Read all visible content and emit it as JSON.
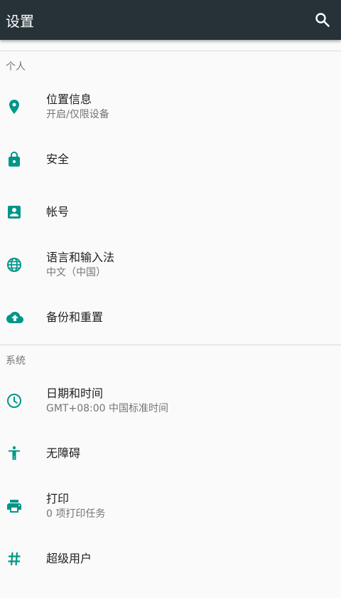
{
  "appbar": {
    "title": "设置",
    "search_icon": "search-icon"
  },
  "colors": {
    "appbar": "#263238",
    "accent": "#009688",
    "background": "#fafafa"
  },
  "sections": [
    {
      "header": "个人",
      "items": [
        {
          "label": "位置信息",
          "summary": "开启/仅限设备",
          "icon": "location-pin-icon"
        },
        {
          "label": "安全",
          "summary": "",
          "icon": "lock-icon"
        },
        {
          "label": "帐号",
          "summary": "",
          "icon": "account-box-icon"
        },
        {
          "label": "语言和输入法",
          "summary": "中文（中国）",
          "icon": "globe-icon"
        },
        {
          "label": "备份和重置",
          "summary": "",
          "icon": "cloud-upload-icon"
        }
      ]
    },
    {
      "header": "系统",
      "items": [
        {
          "label": "日期和时间",
          "summary": "GMT+08:00 中国标准时间",
          "icon": "clock-icon"
        },
        {
          "label": "无障碍",
          "summary": "",
          "icon": "accessibility-icon"
        },
        {
          "label": "打印",
          "summary": "0 项打印任务",
          "icon": "printer-icon"
        },
        {
          "label": "超级用户",
          "summary": "",
          "icon": "hash-icon"
        }
      ]
    }
  ]
}
